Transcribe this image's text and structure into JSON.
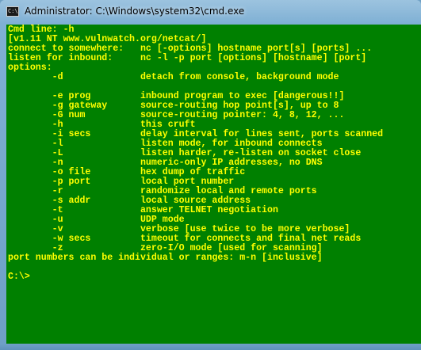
{
  "window": {
    "title": "Administrator: C:\\Windows\\system32\\cmd.exe",
    "icon": "cmd-console-icon",
    "icon_glyph": "C:\\"
  },
  "colors": {
    "console_background": "#008000",
    "console_text": "#ffff00"
  },
  "console": {
    "lines": [
      "Cmd line: -h",
      "[v1.11 NT www.vulnwatch.org/netcat/]",
      "connect to somewhere:   nc [-options] hostname port[s] [ports] ...",
      "listen for inbound:     nc -l -p port [options] [hostname] [port]",
      "options:",
      "        -d              detach from console, background mode",
      "",
      "        -e prog         inbound program to exec [dangerous!!]",
      "        -g gateway      source-routing hop point[s], up to 8",
      "        -G num          source-routing pointer: 4, 8, 12, ...",
      "        -h              this cruft",
      "        -i secs         delay interval for lines sent, ports scanned",
      "        -l              listen mode, for inbound connects",
      "        -L              listen harder, re-listen on socket close",
      "        -n              numeric-only IP addresses, no DNS",
      "        -o file         hex dump of traffic",
      "        -p port         local port number",
      "        -r              randomize local and remote ports",
      "        -s addr         local source address",
      "        -t              answer TELNET negotiation",
      "        -u              UDP mode",
      "        -v              verbose [use twice to be more verbose]",
      "        -w secs         timeout for connects and final net reads",
      "        -z              zero-I/O mode [used for scanning]",
      "port numbers can be individual or ranges: m-n [inclusive]",
      "",
      "C:\\>"
    ]
  }
}
